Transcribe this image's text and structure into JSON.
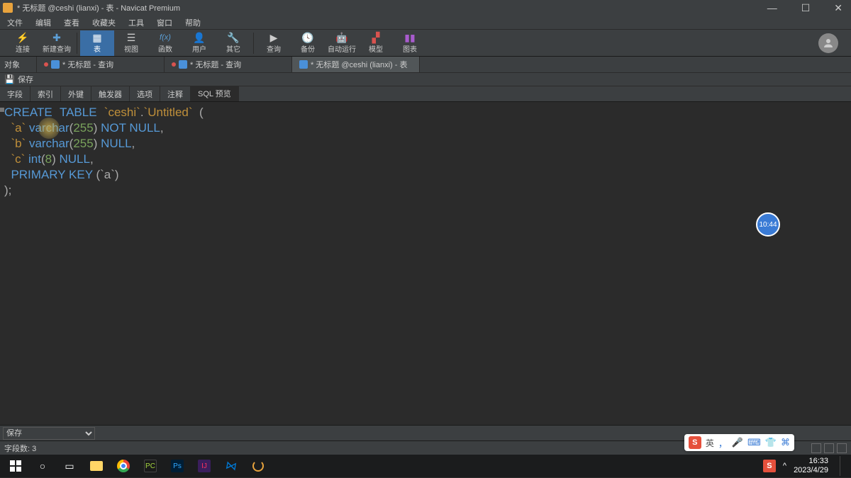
{
  "titlebar": {
    "title": "* 无标题 @ceshi (lianxi) - 表 - Navicat Premium"
  },
  "menubar": [
    "文件",
    "编辑",
    "查看",
    "收藏夹",
    "工具",
    "窗口",
    "帮助"
  ],
  "toolbar": [
    {
      "label": "连接",
      "icon": "🔌"
    },
    {
      "label": "新建查询",
      "icon": "➕"
    },
    {
      "label": "表",
      "icon": "▦",
      "active": true
    },
    {
      "label": "视图",
      "icon": "☰"
    },
    {
      "label": "函数",
      "icon": "f(x)"
    },
    {
      "label": "用户",
      "icon": "👤"
    },
    {
      "label": "其它",
      "icon": "⋯"
    },
    {
      "label": "查询",
      "icon": "🔍"
    },
    {
      "label": "备份",
      "icon": "🗄"
    },
    {
      "label": "自动运行",
      "icon": "🤖"
    },
    {
      "label": "模型",
      "icon": "▞"
    },
    {
      "label": "图表",
      "icon": "📊"
    }
  ],
  "tabs_row": {
    "side_label": "对象",
    "tabs": [
      {
        "label": "* 无标题 - 查询",
        "active": false
      },
      {
        "label": "* 无标题 - 查询",
        "active": false
      },
      {
        "label": "* 无标题 @ceshi (lianxi) - 表",
        "active": true
      }
    ]
  },
  "save_label": "保存",
  "subtabs": [
    "字段",
    "索引",
    "外键",
    "触发器",
    "选项",
    "注释",
    "SQL 预览"
  ],
  "subtab_active": "SQL 预览",
  "sql": {
    "l1a": "CREATE",
    "l1b": "TABLE",
    "l1c": "`ceshi`",
    "l1d": ".",
    "l1e": "`Untitled`",
    "l1f": "  (",
    "l2a": "  `a` ",
    "l2b": "varchar",
    "l2c": "(",
    "l2d": "255",
    "l2e": ") ",
    "l2f": "NOT",
    "l2g": " ",
    "l2h": "NULL",
    "l2i": ",",
    "l3a": "  `b` ",
    "l3b": "varchar",
    "l3c": "(",
    "l3d": "255",
    "l3e": ") ",
    "l3f": "NULL",
    "l3g": ",",
    "l4a": "  `c` ",
    "l4b": "int",
    "l4c": "(",
    "l4d": "8",
    "l4e": ") ",
    "l4f": "NULL",
    "l4g": ",",
    "l5a": "  PRIMARY",
    "l5b": " ",
    "l5c": "KEY",
    "l5d": " (`a`)",
    "l6": ");"
  },
  "clock_badge": "10:44",
  "dropdown": "保存",
  "statusbar": {
    "field_count": "字段数: 3"
  },
  "ime": {
    "lang": "英",
    "punct": "，",
    "mic": "🎤",
    "kb": "⌨",
    "shirt": "👕",
    "grid": "⌘"
  },
  "tray": {
    "time": "16:33",
    "date": "2023/4/29",
    "up": "^"
  }
}
